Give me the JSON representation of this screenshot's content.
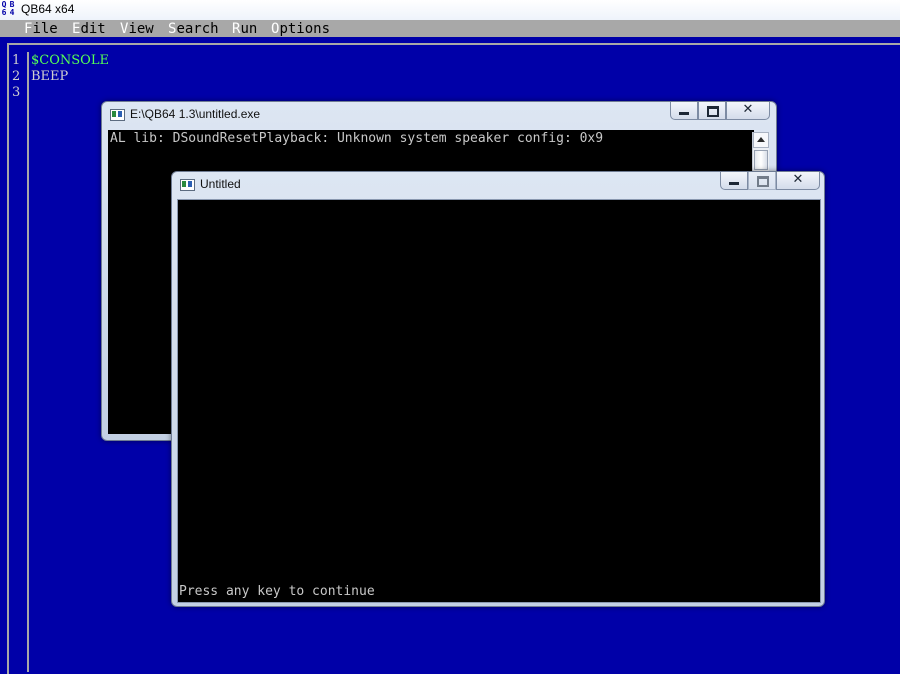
{
  "app": {
    "title": "QB64 x64",
    "icon_glyphs": [
      "Q",
      "B",
      "6",
      "4"
    ]
  },
  "menubar": {
    "items": [
      {
        "hot": "F",
        "rest": "ile"
      },
      {
        "hot": "E",
        "rest": "dit"
      },
      {
        "hot": "V",
        "rest": "iew"
      },
      {
        "hot": "S",
        "rest": "earch"
      },
      {
        "hot": "R",
        "rest": "un"
      },
      {
        "hot": "O",
        "rest": "ptions"
      }
    ]
  },
  "editor": {
    "lines": [
      {
        "number": "1",
        "code": "$CONSOLE",
        "color": "#55ff55"
      },
      {
        "number": "2",
        "code": "BEEP",
        "color": "#d0d0d0"
      },
      {
        "number": "3",
        "code": "",
        "color": "#d0d0d0"
      }
    ]
  },
  "console_window": {
    "title": "E:\\QB64 1.3\\untitled.exe",
    "output": "AL lib: DSoundResetPlayback: Unknown system speaker config: 0x9",
    "minimize_glyph": "",
    "maximize_glyph": "",
    "close_glyph": "✕"
  },
  "program_window": {
    "title": "Untitled",
    "output": "Press any key to continue",
    "close_glyph": "✕"
  },
  "colors": {
    "editor_bg": "#0000a8",
    "menubar_bg": "#a8a8a8",
    "console_bg": "#000000",
    "keyword": "#55ff55"
  }
}
